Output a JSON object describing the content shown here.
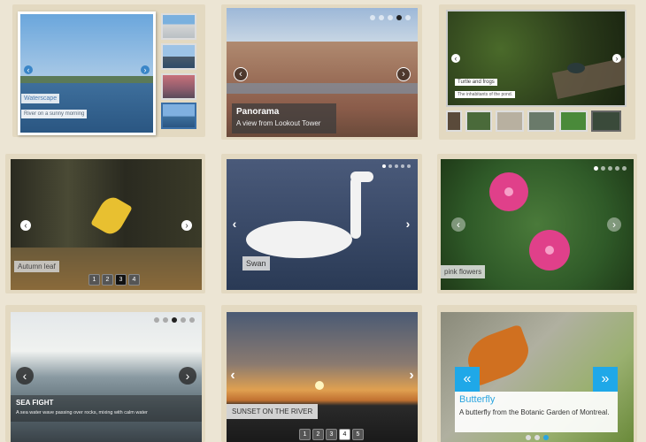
{
  "colors": {
    "background": "#ece5d4",
    "frame": "#e3d9c1",
    "accent_blue": "#2aa5e0",
    "butterfly_arrow": "#1fa8e8"
  },
  "icons": {
    "prev": "‹",
    "next": "›",
    "prev_double": "«",
    "next_double": "»"
  },
  "slider1": {
    "caption_title": "Waterscape",
    "caption_text": "River on a sunny morning"
  },
  "slider2": {
    "caption_title": "Panorama",
    "caption_text": "A view from Lookout Tower",
    "pagination": {
      "count": 5,
      "active": 4
    }
  },
  "slider3": {
    "caption_title": "Turtle and frogs",
    "caption_text": "The inhabitants of the pond."
  },
  "slider4": {
    "caption_title": "Autumn leaf",
    "pages": [
      "1",
      "2",
      "3",
      "4"
    ],
    "active_page": 3
  },
  "slider5": {
    "caption_title": "Swan",
    "pagination": {
      "count": 5,
      "active": 1
    }
  },
  "slider6": {
    "caption_title": "pink flowers",
    "pagination": {
      "count": 5,
      "active": 1
    }
  },
  "slider7": {
    "caption_title": "SEA FIGHT",
    "caption_text": "A sea water wave passing over rocks, mixing with calm water",
    "pagination": {
      "count": 5,
      "active": 3
    }
  },
  "slider8": {
    "caption_title": "SUNSET ON THE RIVER",
    "pages": [
      "1",
      "2",
      "3",
      "4",
      "5"
    ],
    "active_page": 4
  },
  "slider9": {
    "caption_title": "Butterfly",
    "caption_text": "A butterfly from the Botanic Garden of Montreal.",
    "pagination": {
      "count": 3,
      "active": 3
    }
  }
}
